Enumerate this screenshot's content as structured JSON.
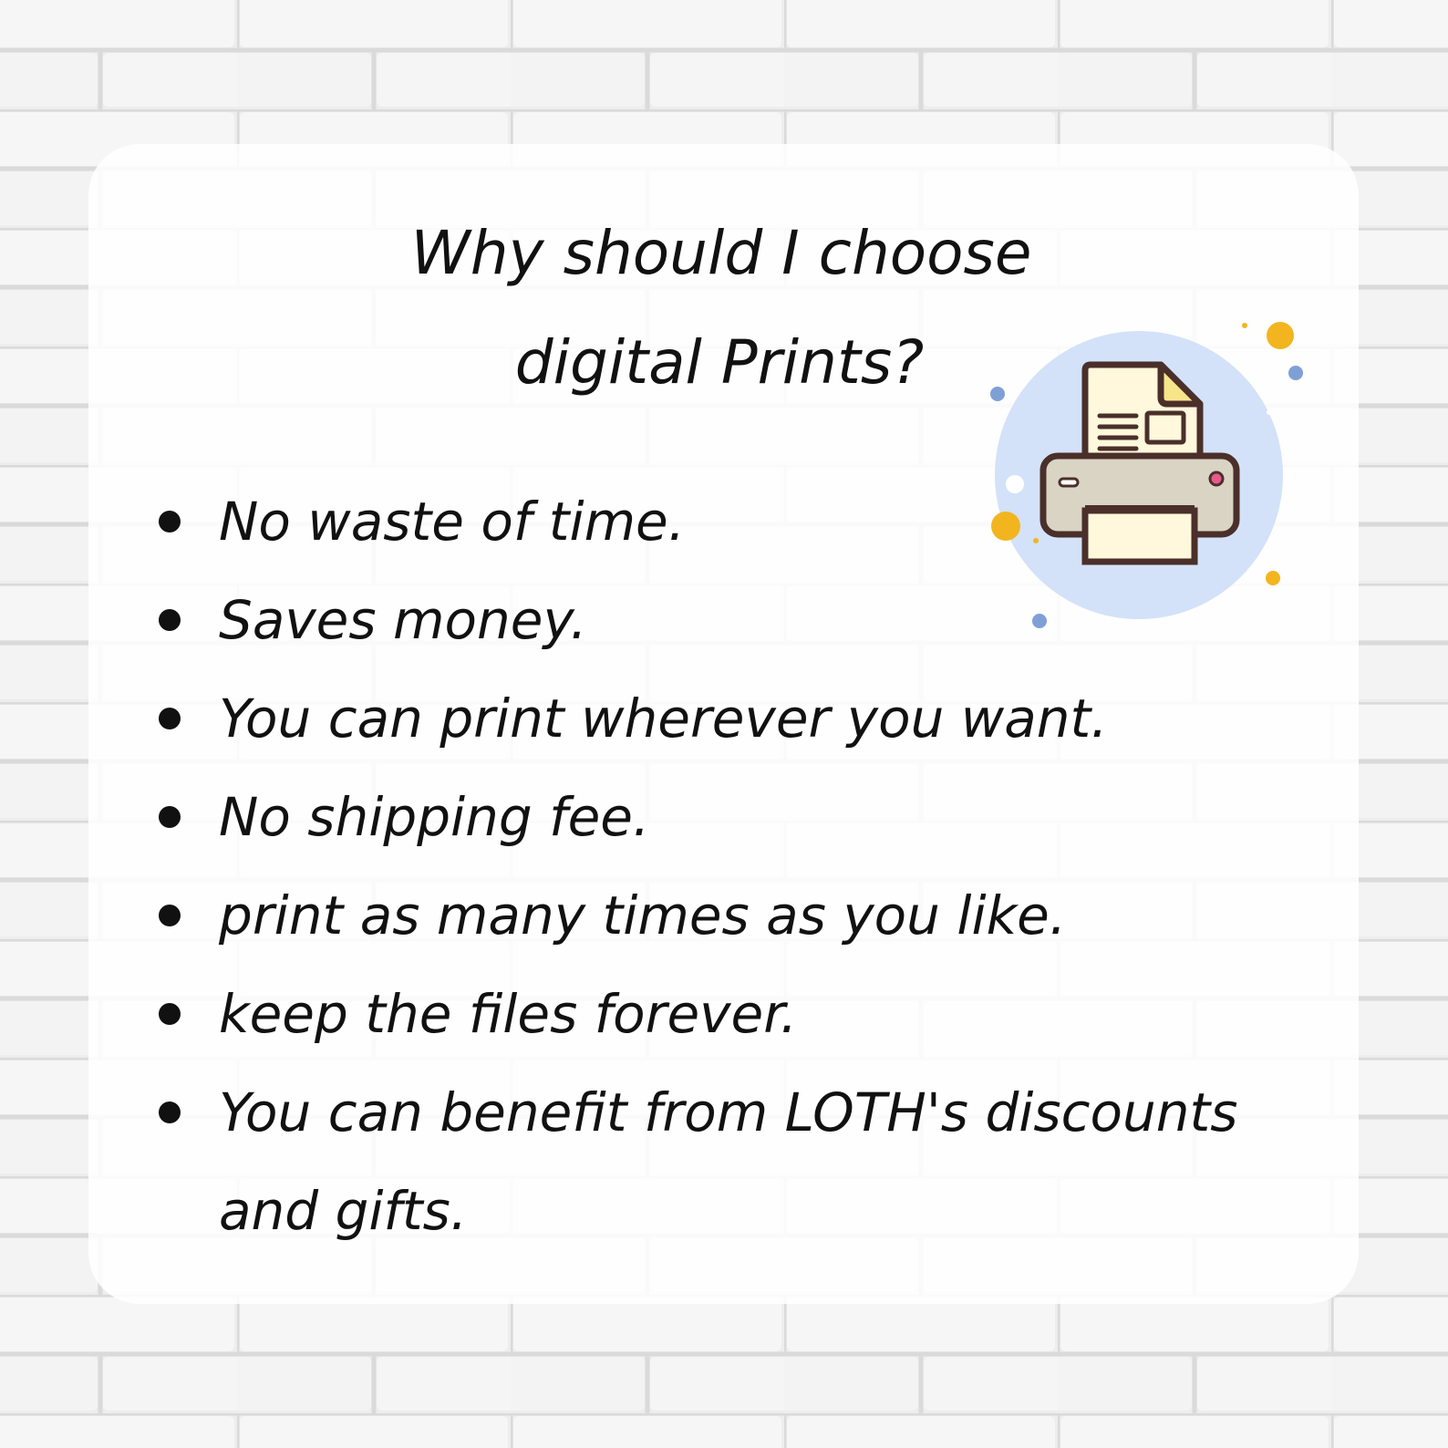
{
  "title": {
    "line1": "Why should I choose",
    "line2": "digital Prints?"
  },
  "benefits": [
    "No waste of time.",
    "Saves money.",
    "You can print wherever you want.",
    "No shipping fee.",
    "print as many times as you like.",
    "keep the files forever.",
    "You can benefit from LOTH's discounts and gifts."
  ],
  "icon": "printer-icon",
  "colors": {
    "wall": "#ececec",
    "card": "#ffffff",
    "text": "#111111",
    "icon_circle": "#d3e2f8",
    "paper": "#fff8dc",
    "paper_corner": "#f7e58a",
    "printer_body": "#d9d4c3",
    "outline": "#4a2f2a",
    "accent_pink": "#e45b8b",
    "dot_yellow": "#f2b51f",
    "dot_blue": "#7ea0d6"
  }
}
